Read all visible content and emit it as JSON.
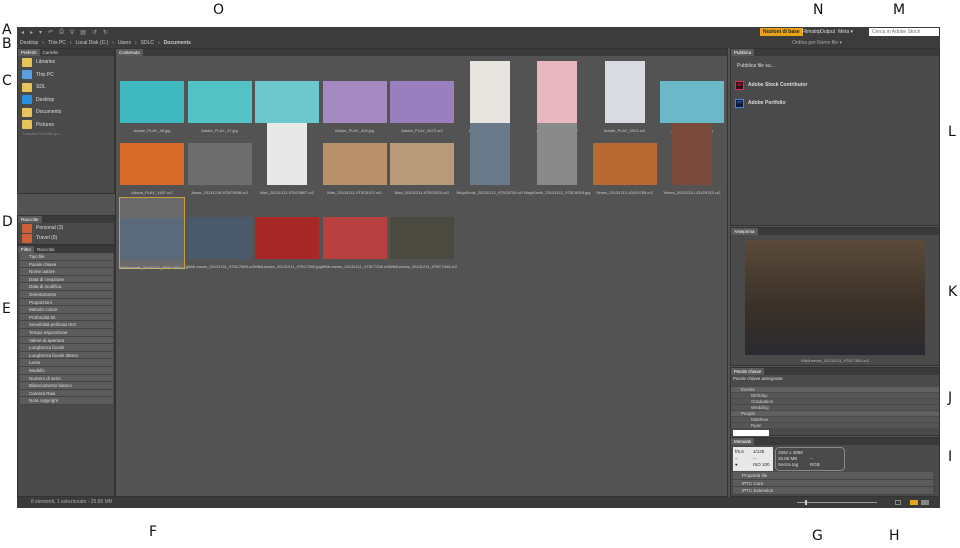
{
  "annotations": [
    "A",
    "B",
    "C",
    "D",
    "E",
    "F",
    "G",
    "H",
    "I",
    "J",
    "K",
    "L",
    "M",
    "N",
    "O"
  ],
  "workspaces": {
    "active": "Nozioni di base",
    "items": [
      "Filmstrip",
      "Output",
      "Meta ▾"
    ]
  },
  "search": {
    "placeholder": "Cerca in Adobe Stock"
  },
  "sort": "Ordina per Nome file ▾",
  "breadcrumb": [
    "Desktop",
    "This PC",
    "Local Disk (C:)",
    "Users",
    "SDLC",
    "Documents"
  ],
  "left": {
    "tabs": [
      "Preferiti",
      "Cartelle"
    ],
    "favorites": [
      "Libraries",
      "This PC",
      "SDL",
      "Desktop",
      "Documents",
      "Pictures"
    ],
    "drag_hint": "Trascina Preferiti qui...",
    "collections_tab": "Raccolte",
    "collections": [
      "Personal (3)",
      "Travel (0)"
    ],
    "filter_tabs": [
      "Filtro",
      "Raccolta"
    ],
    "filters": [
      "Tipo file",
      "Parole chiave",
      "Nome autore",
      "Data di creazione",
      "Data di modifica",
      "Orientamento",
      "Proporzioni",
      "Metodo colore",
      "Profondità bit",
      "Sensibilità pellicola ISO",
      "Tempo esposizione",
      "Valore di apertura",
      "Lunghezza focale",
      "Lunghezza focale 35mm",
      "Lente",
      "Modello",
      "Numero di serie",
      "Bilanciamento bianco",
      "Camera Raw",
      "Nota copyright"
    ]
  },
  "content": {
    "tab": "Contenuto",
    "thumbs": [
      {
        "name": "Adobe_PLAY_46.jpg",
        "color": "#3fb8bf"
      },
      {
        "name": "Adobe_PLAY_47.jpg",
        "color": "#52c2c4"
      },
      {
        "name": "Adobe_PLAY_220.jpg",
        "color": "#6cc8cc"
      },
      {
        "name": "Adobe_PLAY_428.jpg",
        "color": "#a48ac0"
      },
      {
        "name": "Adobe_PLAY_0472.cr2",
        "color": "#9a7fbf"
      },
      {
        "name": "Adobe_PLAY_0508.cr2",
        "color": "#e8e4e0"
      },
      {
        "name": "Adobe_PLAY_0580.cr2",
        "color": "#e8b8c0"
      },
      {
        "name": "Adobe_PLAY_0923.cr2",
        "color": "#d8dce0"
      },
      {
        "name": "Adobe_PLAY_1043.jpg",
        "color": "#6ab8c8"
      },
      {
        "name": "Adobe_PLAY_1457.cr2",
        "color": "#d86a2a"
      },
      {
        "name": "Jesse_20131216-9T5C9036.cr2",
        "color": "#6e6e6e"
      },
      {
        "name": "Mari_20131211-9T5C9807.cr2",
        "color": "#e8e8e8"
      },
      {
        "name": "Mari_20131211-9T5C6107.cr2",
        "color": "#b8906a"
      },
      {
        "name": "Mari_20131211-9T5C6378.cr2",
        "color": "#b89a7a"
      },
      {
        "name": "NinjaSonik_20131212_9T5C8754.cr2",
        "color": "#6a7a8a"
      },
      {
        "name": "NinjaSonik_20131212_9T5C8918.jpg",
        "color": "#8a8a8a"
      },
      {
        "name": "Vimes_20131210-43429785.cr2",
        "color": "#b86a30"
      },
      {
        "name": "Vimes_20131210-43429743.cr2",
        "color": "#7a4a3a"
      },
      {
        "name": "WildLeaves_20131211_9T5C7651.cr2",
        "color": "#5a6a7a"
      },
      {
        "name": "WildLeaves_20131211_9T5C7669.cr2",
        "color": "#4a5a6a"
      },
      {
        "name": "WildLeaves_20131211_9T5C7592.jpg",
        "color": "#a82828"
      },
      {
        "name": "WildLeaves_20131211_9T5C7336.cr2",
        "color": "#b84040"
      },
      {
        "name": "WildLeaves_20131211_9T5C7940.cr2",
        "color": "#4a4a40"
      }
    ]
  },
  "publish": {
    "tab": "Pubblica",
    "title": "Pubblica file su...",
    "items": [
      {
        "icon": "St",
        "label": "Adobe Stock Contributor"
      },
      {
        "icon": "Pf",
        "label": "Adobe Portfolio"
      }
    ]
  },
  "preview": {
    "tab": "Anteprima",
    "caption": "WildLeaves_20131211_9T5C7651.cr2"
  },
  "keywords": {
    "tab": "Parole chiave",
    "subtitle": "Parole chiave assegnate:",
    "groups": [
      {
        "name": "Events",
        "count": "3",
        "items": [
          "Birthday",
          "Graduation",
          "Wedding"
        ]
      },
      {
        "name": "People",
        "count": "2",
        "items": [
          "Matthew",
          "Ryan"
        ]
      }
    ]
  },
  "metadata": {
    "tab": "Metadati",
    "camera": [
      "f/5.6",
      "1/125",
      "--",
      "--",
      "ISO 100"
    ],
    "info": [
      "2592 x 3888",
      "25.85 MB",
      "--",
      "Senza tag",
      "RGB"
    ],
    "sections": [
      "Proprietà file",
      "IPTC Core",
      "IPTC Extension"
    ]
  },
  "status": "8 elementi, 1 selezionato - 25.85 MB",
  "zoom": 0.1
}
